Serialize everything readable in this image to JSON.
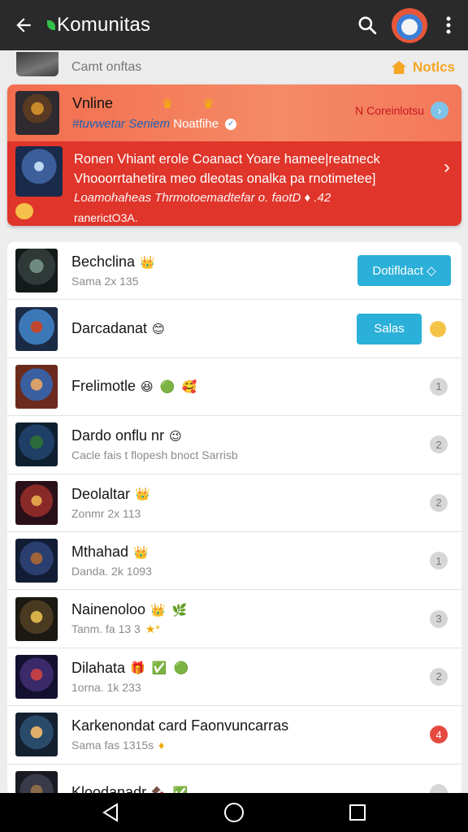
{
  "appbar": {
    "title": "Komunitas",
    "icons": [
      "back-arrow-icon",
      "search-icon",
      "more-vert-icon"
    ]
  },
  "notice_strip": {
    "label": "Camt onftas",
    "notice_label": "Notlcs"
  },
  "featured": {
    "name": "Vnline",
    "sub_handle": "#tuvwetar Seniem",
    "sub_category": "Noatfihe",
    "contact": "N Coreinlotsu",
    "line1": "Ronen Vhiant erole Coanact Yoare hamee|reatneck",
    "line2": "Vhooorrtahetira meo dleotas onalka pa rnotimetee]",
    "line3": "Loamohaheas Thrmotoemadtefar o. faotD ♦ .42",
    "line4": "ranerictO3A."
  },
  "list": [
    {
      "name": "Bechclina",
      "emoji": "👑",
      "meta": "Sama 2x 135",
      "action": "Dotifldact ◇",
      "action_type": "wide"
    },
    {
      "name": "Darcadanat",
      "emoji": "😊",
      "meta": "",
      "action": "Salas",
      "action_type": "narrow"
    },
    {
      "name": "Frelimotle",
      "emoji": "😆 🟢 🥰",
      "meta": "",
      "badge": "1"
    },
    {
      "name": "Dardo onflu nr",
      "emoji": "😉",
      "meta": "Cacle fais t flopesh bnoct Sarrisb",
      "badge": "2"
    },
    {
      "name": "Deolaltar",
      "emoji": "👑",
      "meta": "Zonmr 2x 113",
      "badge": "2"
    },
    {
      "name": "Mthahad",
      "emoji": "👑",
      "meta": "Danda. 2k 1093",
      "badge": "1"
    },
    {
      "name": "Nainenoloo",
      "emoji": "👑 🌿",
      "meta": "Tanm. fa 13 3",
      "meta_star": "★*",
      "badge": "3"
    },
    {
      "name": "Dilahata",
      "emoji": "🎁 ✅ 🟢",
      "meta": "1orna. 1k 233",
      "badge": "2"
    },
    {
      "name": "Karkenondat card Faonvuncarras",
      "emoji": "",
      "meta": "Sama fas 1315s",
      "meta_star": "♦",
      "badge": "4",
      "badge_red": true
    },
    {
      "name": "Kloodanadr",
      "emoji": "🍫 ✅",
      "meta": "",
      "badge": ""
    }
  ],
  "navbar": {
    "icons": [
      "back-triangle-icon",
      "home-circle-icon",
      "recents-square-icon"
    ]
  }
}
